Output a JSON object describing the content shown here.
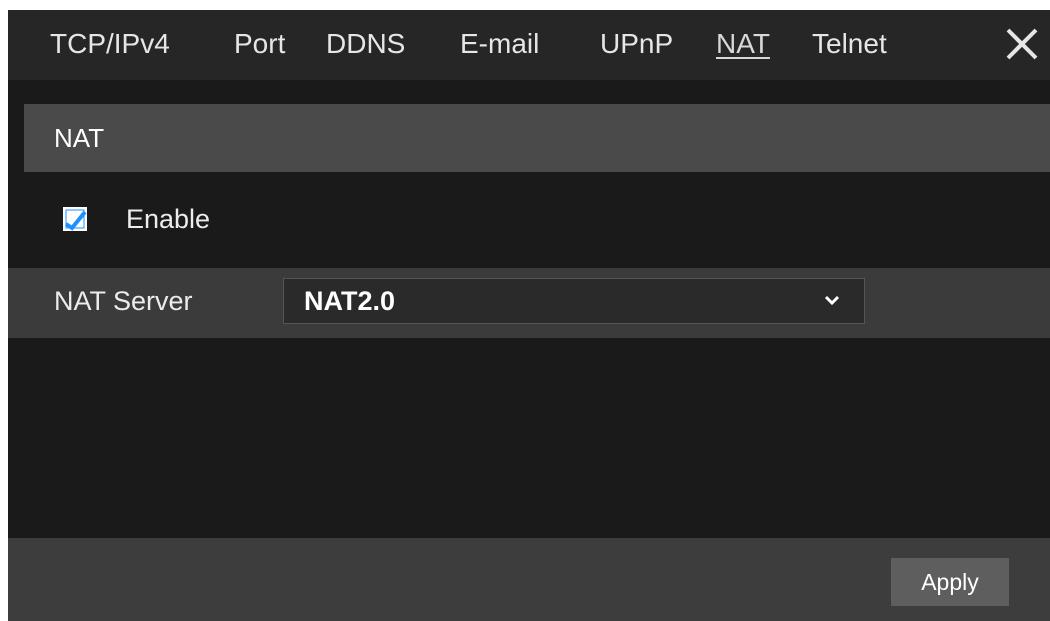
{
  "tabs": [
    {
      "label": "TCP/IPv4"
    },
    {
      "label": "Port"
    },
    {
      "label": "DDNS"
    },
    {
      "label": "E-mail"
    },
    {
      "label": "UPnP"
    },
    {
      "label": "NAT",
      "active": true
    },
    {
      "label": "Telnet"
    }
  ],
  "close_icon": "close-icon",
  "section": {
    "title": "NAT"
  },
  "enable": {
    "label": "Enable",
    "checked": true,
    "check_color": "#1e90ff"
  },
  "nat_server": {
    "label": "NAT Server",
    "selected": "NAT2.0",
    "icon": "chevron-down-icon"
  },
  "footer": {
    "apply_label": "Apply"
  },
  "colors": {
    "background": "#1a1a1a",
    "tabbar": "#262626",
    "section_header": "#4a4a4a",
    "row": "#3b3b3b",
    "footer": "#3d3d3d",
    "button": "#5e5e5e",
    "accent": "#1e90ff"
  }
}
